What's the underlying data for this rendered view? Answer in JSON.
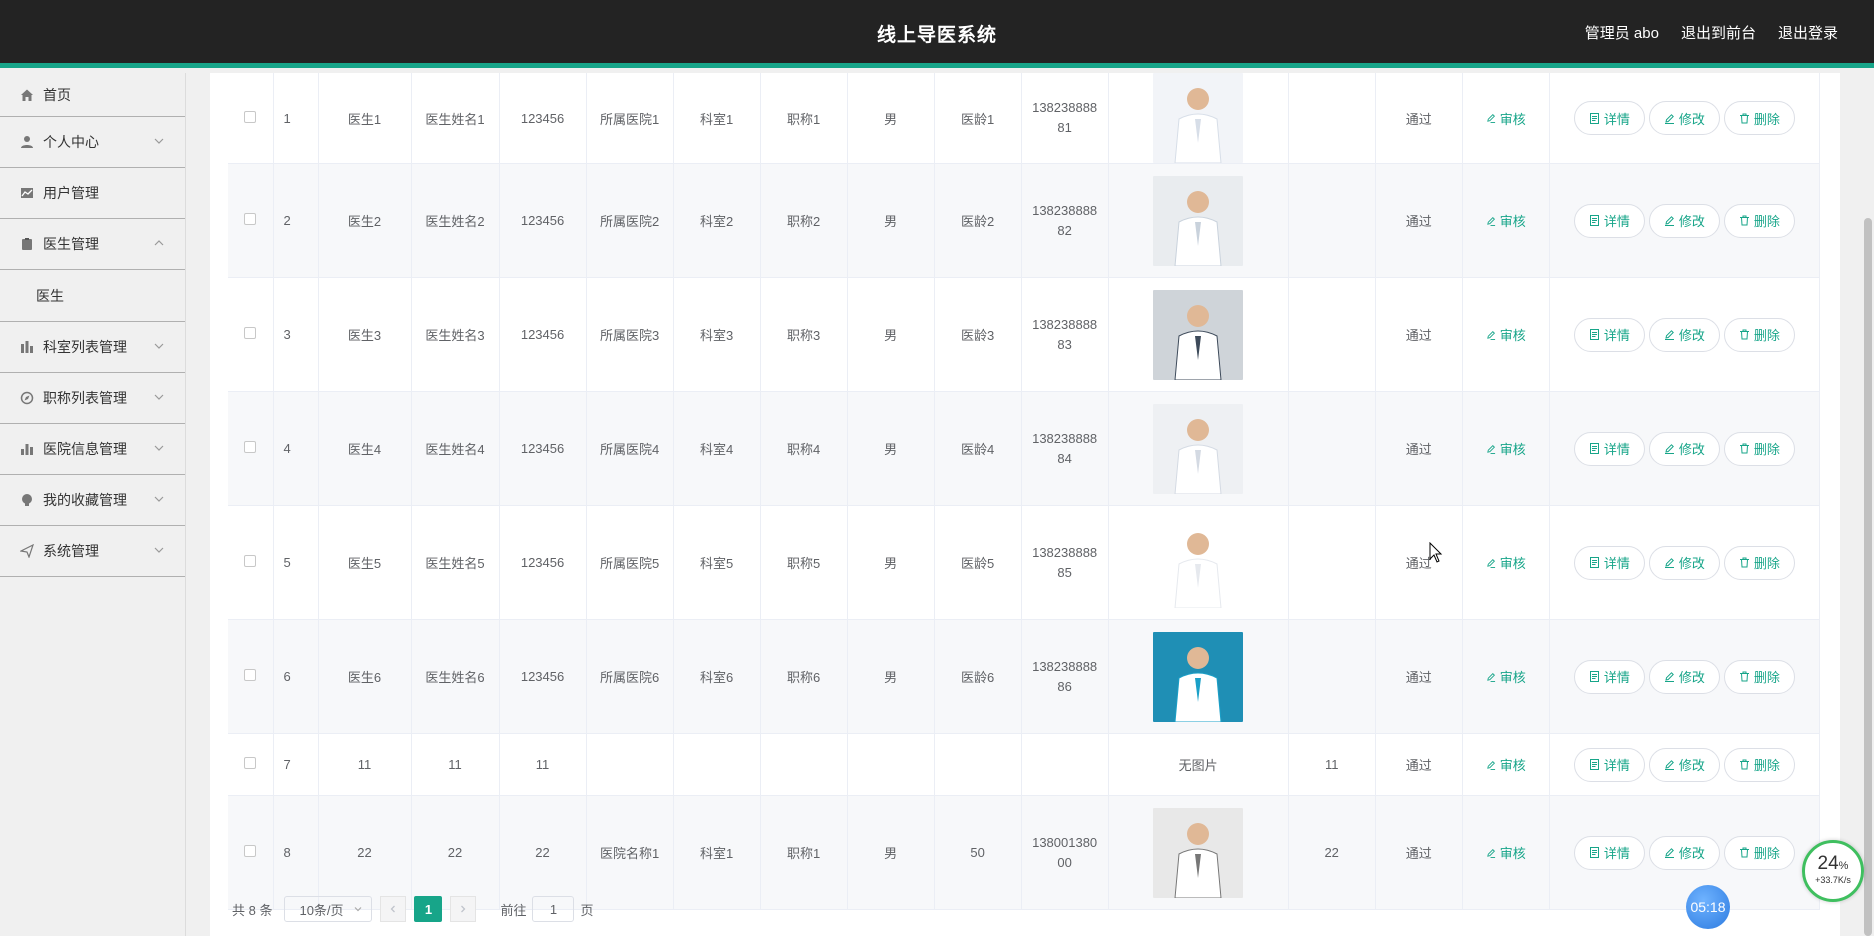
{
  "header": {
    "title": "线上导医系统",
    "admin_label": "管理员 abo",
    "front_label": "退出到前台",
    "logout_label": "退出登录"
  },
  "sidebar": {
    "home": "首页",
    "personal": "个人中心",
    "users": "用户管理",
    "doctors": "医生管理",
    "doctor_sub": "医生",
    "departments": "科室列表管理",
    "titles": "职称列表管理",
    "hospitals": "医院信息管理",
    "favorites": "我的收藏管理",
    "system": "系统管理"
  },
  "actions": {
    "audit": "审核",
    "detail": "详情",
    "edit": "修改",
    "delete": "删除"
  },
  "rows": [
    {
      "idx": "1",
      "account": "医生1",
      "name": "医生姓名1",
      "pwd": "123456",
      "hospital": "所属医院1",
      "dept": "科室1",
      "title": "职称1",
      "gender": "男",
      "age": "医龄1",
      "phone_a": "138238888",
      "phone_b": "81",
      "photo": "doctor-photo",
      "extra": "",
      "status": "通过"
    },
    {
      "idx": "2",
      "account": "医生2",
      "name": "医生姓名2",
      "pwd": "123456",
      "hospital": "所属医院2",
      "dept": "科室2",
      "title": "职称2",
      "gender": "男",
      "age": "医龄2",
      "phone_a": "138238888",
      "phone_b": "82",
      "photo": "doctor-photo",
      "extra": "",
      "status": "通过"
    },
    {
      "idx": "3",
      "account": "医生3",
      "name": "医生姓名3",
      "pwd": "123456",
      "hospital": "所属医院3",
      "dept": "科室3",
      "title": "职称3",
      "gender": "男",
      "age": "医龄3",
      "phone_a": "138238888",
      "phone_b": "83",
      "photo": "doctor-photo",
      "extra": "",
      "status": "通过"
    },
    {
      "idx": "4",
      "account": "医生4",
      "name": "医生姓名4",
      "pwd": "123456",
      "hospital": "所属医院4",
      "dept": "科室4",
      "title": "职称4",
      "gender": "男",
      "age": "医龄4",
      "phone_a": "138238888",
      "phone_b": "84",
      "photo": "doctor-photo",
      "extra": "",
      "status": "通过"
    },
    {
      "idx": "5",
      "account": "医生5",
      "name": "医生姓名5",
      "pwd": "123456",
      "hospital": "所属医院5",
      "dept": "科室5",
      "title": "职称5",
      "gender": "男",
      "age": "医龄5",
      "phone_a": "138238888",
      "phone_b": "85",
      "photo": "doctor-photo",
      "extra": "",
      "status": "通过"
    },
    {
      "idx": "6",
      "account": "医生6",
      "name": "医生姓名6",
      "pwd": "123456",
      "hospital": "所属医院6",
      "dept": "科室6",
      "title": "职称6",
      "gender": "男",
      "age": "医龄6",
      "phone_a": "138238888",
      "phone_b": "86",
      "photo": "doctor-photo",
      "extra": "",
      "status": "通过"
    },
    {
      "idx": "7",
      "account": "11",
      "name": "11",
      "pwd": "11",
      "hospital": "",
      "dept": "",
      "title": "",
      "gender": "",
      "age": "",
      "phone_a": "",
      "phone_b": "",
      "photo_text": "无图片",
      "extra": "11",
      "status": "通过"
    },
    {
      "idx": "8",
      "account": "22",
      "name": "22",
      "pwd": "22",
      "hospital": "医院名称1",
      "dept": "科室1",
      "title": "职称1",
      "gender": "男",
      "age": "50",
      "phone_a": "138001380",
      "phone_b": "00",
      "photo": "doctor-photo",
      "extra": "22",
      "status": "通过"
    }
  ],
  "pagination": {
    "total": "共 8 条",
    "page_size": "10条/页",
    "current": "1",
    "goto_label": "前往",
    "goto_value": "1",
    "page_suffix": "页"
  },
  "overlays": {
    "timer": "05:18",
    "net_pct": "24",
    "net_unit": "%",
    "net_speed": "+33.7K/s"
  },
  "colors": {
    "accent": "#17a589",
    "topbar": "#232323"
  }
}
